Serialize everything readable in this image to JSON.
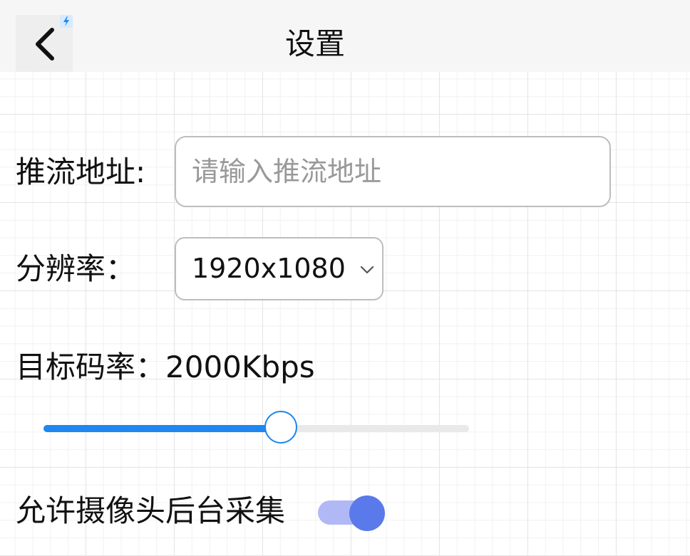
{
  "header": {
    "title": "设置",
    "back_icon": "chevron-left-icon",
    "badge_icon": "lightning-bolt-icon"
  },
  "form": {
    "push_url": {
      "label": "推流地址:",
      "value": "",
      "placeholder": "请输入推流地址"
    },
    "resolution": {
      "label": "分辨率：",
      "selected": "1920x1080"
    },
    "bitrate": {
      "label": "目标码率：",
      "value_text": "2000Kbps",
      "slider_fraction": 0.56
    },
    "background_capture": {
      "label": "允许摄像头后台采集",
      "enabled": true
    }
  },
  "colors": {
    "accent": "#1e87f0",
    "toggle_on": "#5a79ea",
    "toggle_track": "#b0b9f6",
    "border": "#bdbdbd"
  }
}
